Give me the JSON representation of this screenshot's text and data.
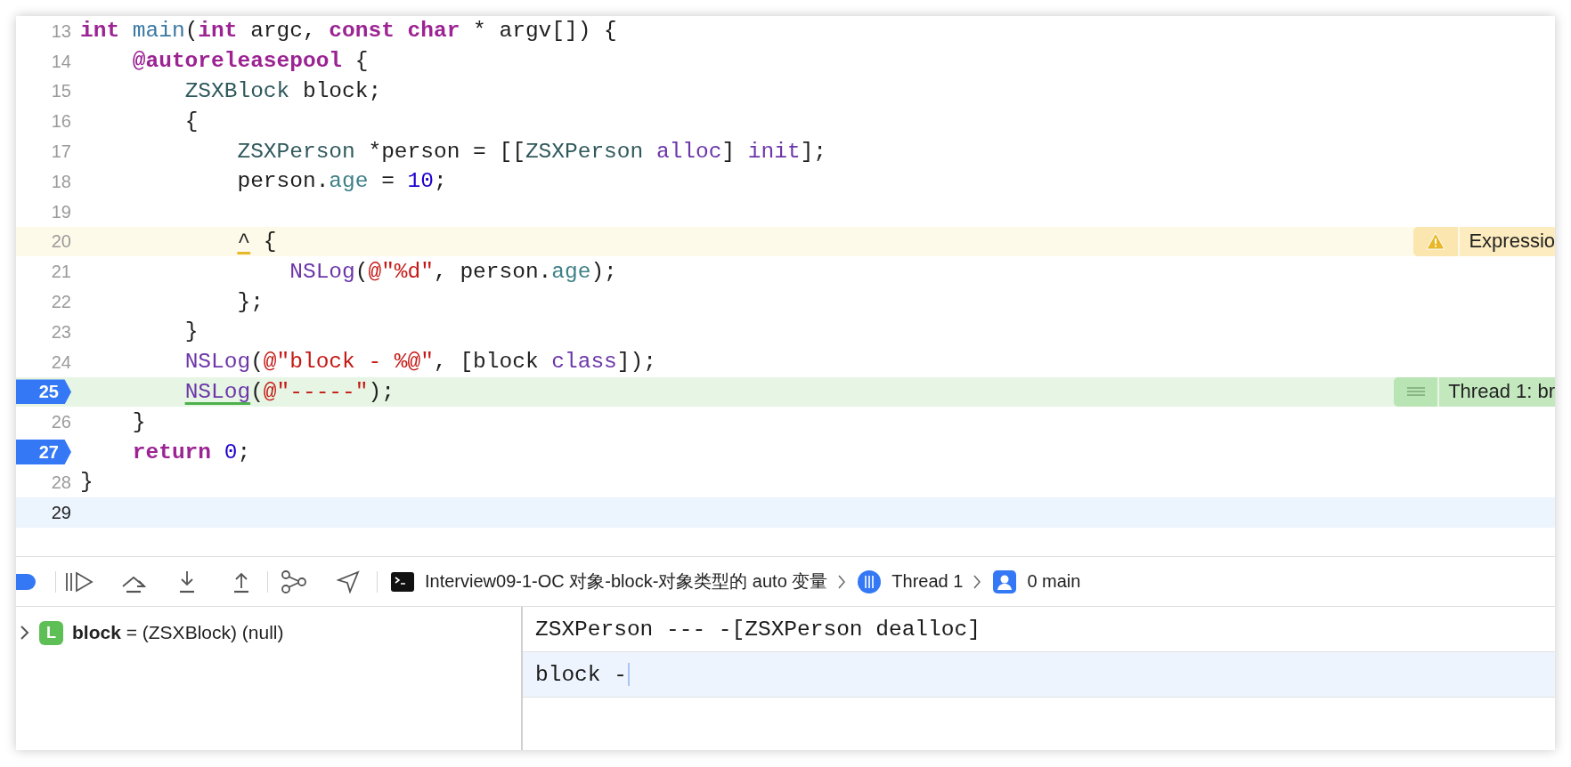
{
  "editor": {
    "lines": [
      {
        "number": "13",
        "breakpoint": false,
        "cursor": false,
        "tokens": [
          {
            "kind": "keyword",
            "text": "int"
          },
          {
            "kind": "decl",
            "text": " main"
          },
          {
            "kind": "plain",
            "text": "("
          },
          {
            "kind": "keyword",
            "text": "int"
          },
          {
            "kind": "plain",
            "text": " argc, "
          },
          {
            "kind": "keyword",
            "text": "const"
          },
          {
            "kind": "keyword",
            "text": " char"
          },
          {
            "kind": "plain",
            "text": " * argv[]) {"
          }
        ]
      },
      {
        "number": "14",
        "breakpoint": false,
        "cursor": false,
        "tokens": [
          {
            "kind": "keyword",
            "text": "    @autoreleasepool"
          },
          {
            "kind": "plain",
            "text": " {"
          }
        ]
      },
      {
        "number": "15",
        "breakpoint": false,
        "cursor": false,
        "tokens": [
          {
            "kind": "type",
            "text": "        ZSXBlock"
          },
          {
            "kind": "plain",
            "text": " block;"
          }
        ]
      },
      {
        "number": "16",
        "breakpoint": false,
        "cursor": false,
        "tokens": [
          {
            "kind": "plain",
            "text": "        {"
          }
        ]
      },
      {
        "number": "17",
        "breakpoint": false,
        "cursor": false,
        "tokens": [
          {
            "kind": "type",
            "text": "            ZSXPerson"
          },
          {
            "kind": "plain",
            "text": " *person = [["
          },
          {
            "kind": "type",
            "text": "ZSXPerson"
          },
          {
            "kind": "call",
            "text": " alloc"
          },
          {
            "kind": "plain",
            "text": "] "
          },
          {
            "kind": "call",
            "text": "init"
          },
          {
            "kind": "plain",
            "text": "];"
          }
        ]
      },
      {
        "number": "18",
        "breakpoint": false,
        "cursor": false,
        "tokens": [
          {
            "kind": "plain",
            "text": "            person."
          },
          {
            "kind": "property",
            "text": "age"
          },
          {
            "kind": "plain",
            "text": " = "
          },
          {
            "kind": "number",
            "text": "10"
          },
          {
            "kind": "plain",
            "text": ";"
          }
        ]
      },
      {
        "number": "19",
        "breakpoint": false,
        "cursor": false
      },
      {
        "number": "20",
        "breakpoint": false,
        "cursor": false,
        "annotation": {
          "kind": "warning",
          "text": "Expressio"
        },
        "tokens": [
          {
            "kind": "plain",
            "text": "            ^",
            "underlined": true
          },
          {
            "kind": "plain",
            "text": " {"
          }
        ]
      },
      {
        "number": "21",
        "breakpoint": false,
        "cursor": false,
        "tokens": [
          {
            "kind": "call",
            "text": "                NSLog"
          },
          {
            "kind": "plain",
            "text": "("
          },
          {
            "kind": "string",
            "text": "@\"%d\""
          },
          {
            "kind": "plain",
            "text": ", person."
          },
          {
            "kind": "property",
            "text": "age"
          },
          {
            "kind": "plain",
            "text": ");"
          }
        ]
      },
      {
        "number": "22",
        "breakpoint": false,
        "cursor": false,
        "tokens": [
          {
            "kind": "plain",
            "text": "            };"
          }
        ]
      },
      {
        "number": "23",
        "breakpoint": false,
        "cursor": false,
        "tokens": [
          {
            "kind": "plain",
            "text": "        }"
          }
        ]
      },
      {
        "number": "24",
        "breakpoint": false,
        "cursor": false,
        "tokens": [
          {
            "kind": "call",
            "text": "        NSLog"
          },
          {
            "kind": "plain",
            "text": "("
          },
          {
            "kind": "string",
            "text": "@\"block - %@\""
          },
          {
            "kind": "plain",
            "text": ", [block "
          },
          {
            "kind": "call",
            "text": "class"
          },
          {
            "kind": "plain",
            "text": "]);"
          }
        ]
      },
      {
        "number": "25",
        "breakpoint": true,
        "cursor": false,
        "annotation": {
          "kind": "thread",
          "text": "Thread 1: br"
        },
        "tokens": [
          {
            "kind": "call",
            "text": "        NSLog",
            "underlined": true
          },
          {
            "kind": "plain",
            "text": "("
          },
          {
            "kind": "string",
            "text": "@\"-----\""
          },
          {
            "kind": "plain",
            "text": ");"
          }
        ]
      },
      {
        "number": "26",
        "breakpoint": false,
        "cursor": false,
        "tokens": [
          {
            "kind": "plain",
            "text": "    }"
          }
        ]
      },
      {
        "number": "27",
        "breakpoint": true,
        "cursor": false,
        "tokens": [
          {
            "kind": "keyword",
            "text": "    return"
          },
          {
            "kind": "number",
            "text": " 0"
          },
          {
            "kind": "plain",
            "text": ";"
          }
        ]
      },
      {
        "number": "28",
        "breakpoint": false,
        "cursor": false,
        "tokens": [
          {
            "kind": "plain",
            "text": "}"
          }
        ]
      },
      {
        "number": "29",
        "breakpoint": false,
        "cursor": true
      }
    ]
  },
  "debug_bar": {
    "breakpoints_active": true,
    "breadcrumb": [
      {
        "kind": "process",
        "text": "Interview09-1-OC 对象-block-对象类型的 auto 变量"
      },
      {
        "kind": "thread",
        "text": "Thread 1"
      },
      {
        "kind": "frame",
        "text": "0 main"
      }
    ]
  },
  "variables": [
    {
      "kind": "local",
      "badge": "L",
      "text": "**block** = (ZSXBlock) (null)",
      "expanded": false
    }
  ],
  "console": {
    "lines": [
      {
        "text": "ZSXPerson --- -[ZSXPerson dealloc]",
        "current": false
      },
      {
        "text": "block -",
        "current": true
      }
    ]
  }
}
